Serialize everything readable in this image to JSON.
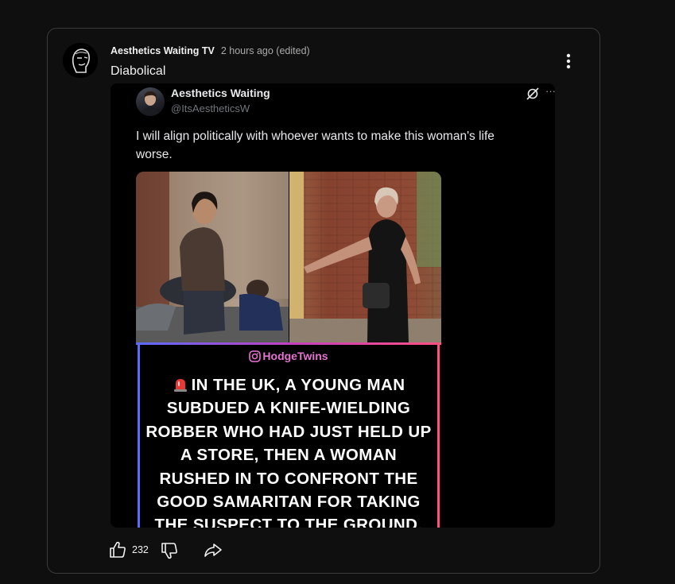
{
  "post": {
    "channel_name": "Aesthetics Waiting TV",
    "time": "2 hours ago (edited)",
    "text": "Diabolical",
    "likes": "232"
  },
  "tweet": {
    "name": "Aesthetics Waiting",
    "handle": "@ItsAestheticsW",
    "more": "···",
    "text": "I will align politically with whoever wants to make this woman's life worse.",
    "media": {
      "ig_handle": "HodgeTwins",
      "headline": "IN THE UK, A YOUNG MAN SUBDUED A KNIFE-WIELDING ROBBER WHO HAD JUST HELD UP A STORE, THEN A WOMAN RUSHED IN TO CONFRONT THE GOOD SAMARITAN FOR TAKING THE SUSPECT TO THE GROUND."
    }
  },
  "icons": {
    "more": "vertical-ellipsis",
    "like": "thumbs-up",
    "dislike": "thumbs-down",
    "share": "share-arrow",
    "grok": "grok-logo",
    "instagram": "instagram-logo",
    "siren": "siren-emoji"
  },
  "colors": {
    "background": "#0f0f0f",
    "card_border": "#3a3a3a",
    "ig_handle": "#e872d2",
    "secondary_text": "#aaaaaa",
    "tweet_handle": "#71767b"
  }
}
